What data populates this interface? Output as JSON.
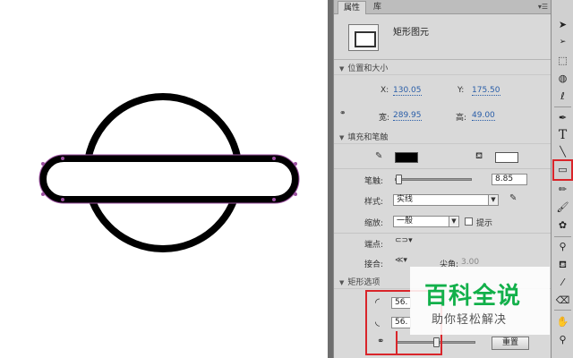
{
  "panel": {
    "tabs": [
      {
        "label": "属性",
        "active": true
      },
      {
        "label": "库",
        "active": false
      }
    ],
    "tab_menu_icon": "panel-menu-icon",
    "header_title": "矩形图元",
    "sections": {
      "position_size": {
        "title": "位置和大小",
        "x_label": "X:",
        "x_value": "130.05",
        "y_label": "Y:",
        "y_value": "175.50",
        "width_label": "宽:",
        "width_value": "289.95",
        "height_label": "高:",
        "height_value": "49.00",
        "lock_icon": "link-lock-icon"
      },
      "fill_stroke": {
        "title": "填充和笔触",
        "stroke_color": "#000000",
        "fill_color": "#ffffff",
        "stroke_label": "笔触:",
        "stroke_value": "8.85",
        "stroke_slider_level": 0.02,
        "style_label": "样式:",
        "style_value": "实线",
        "scale_label": "缩放:",
        "scale_value": "一般",
        "hint_label": "提示",
        "cap_label": "端点:",
        "join_label": "接合:",
        "miter_label": "尖角:",
        "miter_value": "3.00"
      },
      "rect_options": {
        "title": "矩形选项",
        "corner_value_1": "56.",
        "corner_value_2": "56.",
        "corner_slider_level": 0.5,
        "reset_label": "重置"
      }
    }
  },
  "watermark": {
    "title": "百科全说",
    "subtitle": "助你轻松解决"
  },
  "toolbar": {
    "tools": [
      "selection-tool-icon",
      "subselection-tool-icon",
      "free-transform-tool-icon",
      "3d-rotation-tool-icon",
      "lasso-tool-icon",
      "pen-tool-icon",
      "text-tool-icon",
      "line-tool-icon",
      "rectangle-tool-icon",
      "pencil-tool-icon",
      "brush-tool-icon",
      "deco-tool-icon",
      "bone-tool-icon",
      "paint-bucket-tool-icon",
      "eyedropper-tool-icon",
      "eraser-tool-icon",
      "hand-tool-icon",
      "zoom-tool-icon"
    ],
    "selected_tool": "rectangle-tool-icon",
    "text_tool_glyph": "T"
  },
  "colors": {
    "highlight_red": "#d9252a",
    "value_blue": "#2a5ea8",
    "watermark_green": "#12b04a",
    "selection_purple": "#9b4fa0"
  }
}
